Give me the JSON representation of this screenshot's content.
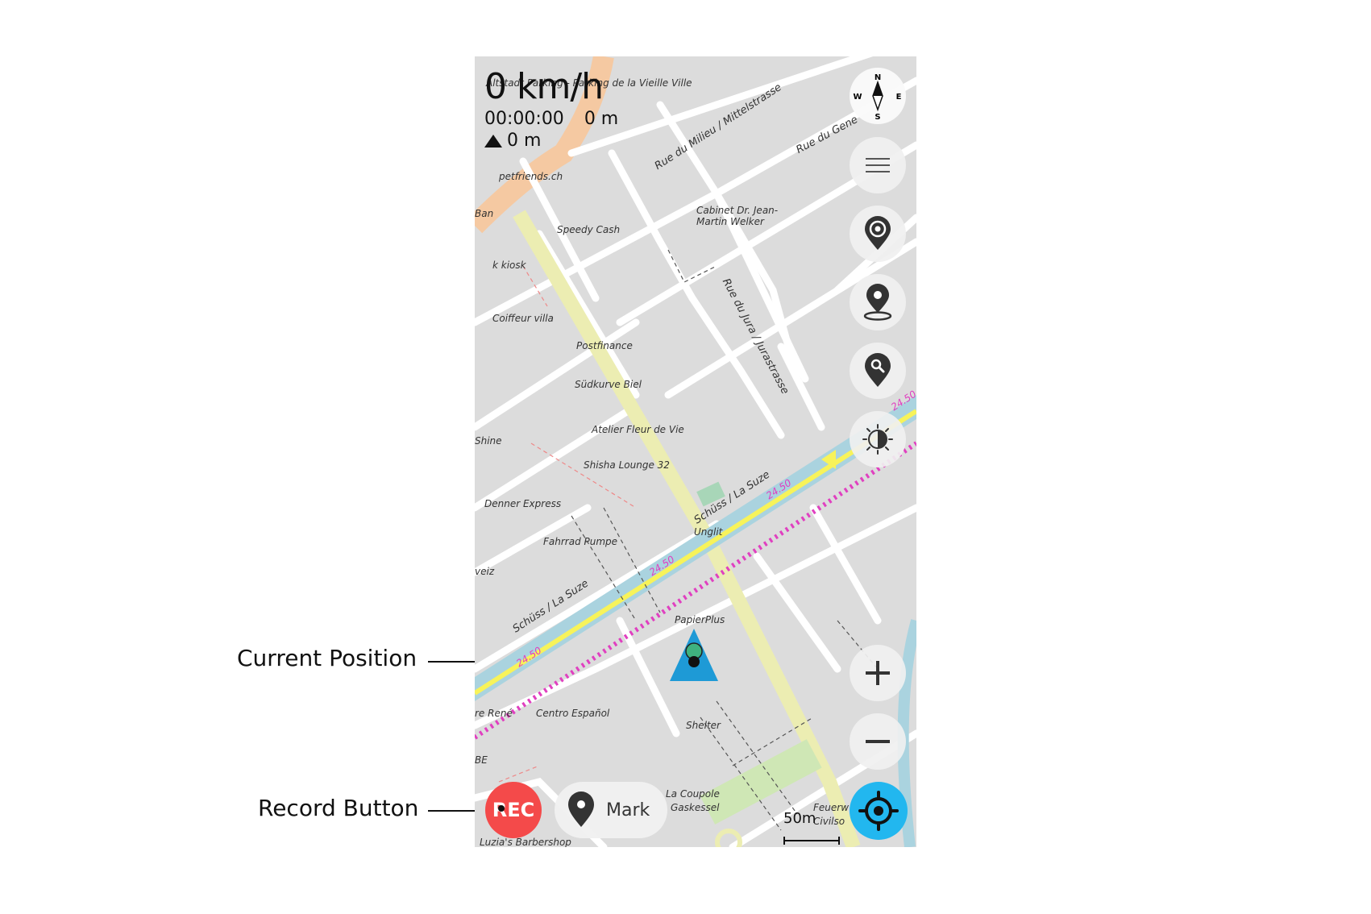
{
  "annotations": {
    "current_position": "Current Position",
    "record_button": "Record Button"
  },
  "hud": {
    "speed": "0 km/h",
    "elapsed": "00:00:00",
    "distance": "0 m",
    "altitude": "0 m"
  },
  "map": {
    "streets": [
      "Rue du Milieu / Mittelstrasse",
      "Rue du Jura / Jurastrasse",
      "Rue du Gene",
      "Schüss / La Suze"
    ],
    "labels": [
      "Altstadt Parking - Parking de la Vieille Ville",
      "petfriends.ch",
      "Speedy Cash",
      "Cabinet Dr. Jean-Martin Welker",
      "k kiosk",
      "Coiffeur villa",
      "Postfinance",
      "Südkurve Biel",
      "Atelier Fleur de Vie",
      "Shisha Lounge 32",
      "Denner Express",
      "Fahrrad Pumpe",
      "Unglit",
      "PapierPlus",
      "Centro Español",
      "Shelter",
      "La Coupole",
      "Gaskessel",
      "Luzia's Barbershop",
      "Shine",
      "Ban",
      "re René",
      "veiz",
      "BE",
      "Feuerw",
      "Civilso"
    ],
    "contour_labels": [
      "24.50",
      "24.50",
      "24.50",
      "24.50"
    ],
    "scale_label": "50m"
  },
  "controls": {
    "rec_label": "REC",
    "mark_label": "Mark",
    "compass": {
      "n": "N",
      "s": "S",
      "e": "E",
      "w": "W"
    }
  },
  "colors": {
    "rec": "#f44a4a",
    "locate": "#22b7ef",
    "position_marker": "#1e9ad6",
    "river": "#aad3df",
    "path_yellow": "#f7f35a",
    "boundary_magenta": "#e040c0"
  }
}
